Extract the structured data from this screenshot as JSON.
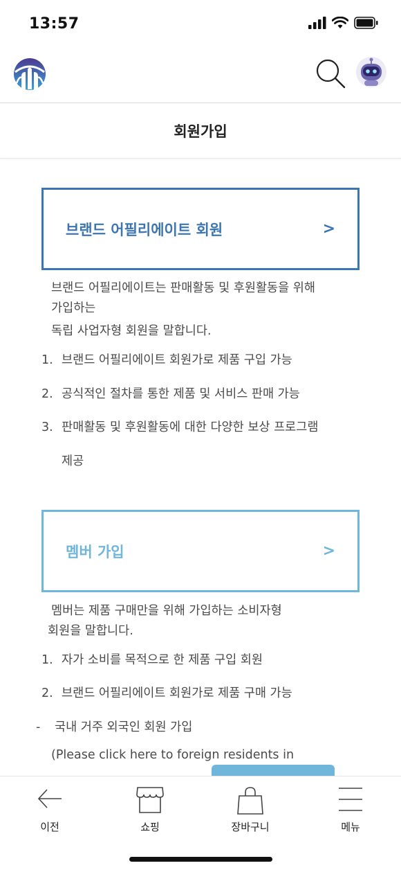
{
  "status_bar": {
    "time": "13:57"
  },
  "page": {
    "title": "회원가입"
  },
  "brand_card": {
    "label": "브랜드 어필리에이트 회원",
    "arrow": ">"
  },
  "brand_desc": {
    "line1": "브랜드 어필리에이트는 판매활동 및 후원활동을 위해",
    "line2": "가입하는",
    "line3": "독립 사업자형 회원을 말합니다.",
    "items": [
      {
        "num": "1.",
        "text": "브랜드 어필리에이트 회원가로 제품 구입 가능"
      },
      {
        "num": "2.",
        "text": "공식적인 절차를 통한 제품 및 서비스 판매 가능"
      },
      {
        "num": "3.",
        "text": "판매활동 및 후원활동에 대한 다양한 보상 프로그램",
        "cont": "제공"
      }
    ]
  },
  "member_card": {
    "label": "멤버 가입",
    "arrow": ">"
  },
  "member_desc": {
    "line1": "멤버는 제품 구매만을 위해 가입하는 소비자형",
    "line2": "회원을 말합니다.",
    "items": [
      {
        "num": "1.",
        "text": "자가 소비를 목적으로 한 제품 구입 회원"
      },
      {
        "num": "2.",
        "text": "브랜드 어필리에이트 회원가로 제품 구매 가능"
      }
    ],
    "foreign": {
      "dash": "-",
      "text": "국내 거주 외국인 회원 가입",
      "note": "(Please click here to foreign residents in"
    }
  },
  "bottom_nav": {
    "items": [
      {
        "label": "이전",
        "icon": "back-arrow-icon"
      },
      {
        "label": "쇼핑",
        "icon": "shop-icon"
      },
      {
        "label": "장바구니",
        "icon": "shopping-bag-icon"
      },
      {
        "label": "메뉴",
        "icon": "hamburger-menu-icon"
      }
    ]
  },
  "colors": {
    "brand_blue": "#3b76b3",
    "member_blue": "#6fb6da"
  }
}
